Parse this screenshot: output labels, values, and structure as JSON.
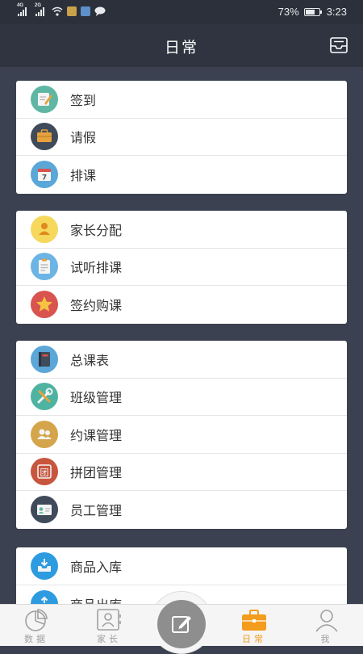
{
  "status_bar": {
    "network_1": "4G",
    "network_2": "2G",
    "battery_percent": "73%",
    "battery_level": 0.73,
    "time": "3:23"
  },
  "header": {
    "title": "日常",
    "action_icon": "inbox-icon"
  },
  "sections": [
    {
      "items": [
        {
          "label": "签到",
          "icon": "pencil-note-icon",
          "color": "#5fb7a3"
        },
        {
          "label": "请假",
          "icon": "briefcase-icon",
          "color": "#3f4a5a"
        },
        {
          "label": "排课",
          "icon": "calendar-icon",
          "color": "#5aa7d8"
        }
      ]
    },
    {
      "items": [
        {
          "label": "家长分配",
          "icon": "person-icon",
          "color": "#f5d85c"
        },
        {
          "label": "试听排课",
          "icon": "clipboard-icon",
          "color": "#6cb4e4"
        },
        {
          "label": "签约购课",
          "icon": "star-icon",
          "color": "#d9534f"
        }
      ]
    },
    {
      "items": [
        {
          "label": "总课表",
          "icon": "book-icon",
          "color": "#5aa7d8"
        },
        {
          "label": "班级管理",
          "icon": "tools-icon",
          "color": "#4fb3a2"
        },
        {
          "label": "约课管理",
          "icon": "people-icon",
          "color": "#d4a54a"
        },
        {
          "label": "拼团管理",
          "icon": "group-badge-icon",
          "color": "#c8553d"
        },
        {
          "label": "员工管理",
          "icon": "id-card-icon",
          "color": "#3f4a5a"
        }
      ]
    },
    {
      "items": [
        {
          "label": "商品入库",
          "icon": "inbox-in-icon",
          "color": "#2d9be0"
        },
        {
          "label": "商品出库",
          "icon": "inbox-out-icon",
          "color": "#2d9be0"
        }
      ]
    }
  ],
  "tab_bar": {
    "tabs": [
      {
        "label": "数据",
        "icon": "pie-chart-icon",
        "active": false
      },
      {
        "label": "家长",
        "icon": "contact-card-icon",
        "active": false
      },
      {
        "label": "日常",
        "icon": "briefcase-icon",
        "active": true
      },
      {
        "label": "我",
        "icon": "user-icon",
        "active": false
      }
    ],
    "center_button_icon": "edit-icon",
    "active_color": "#f39c1e",
    "inactive_color": "#a0a0a0"
  }
}
